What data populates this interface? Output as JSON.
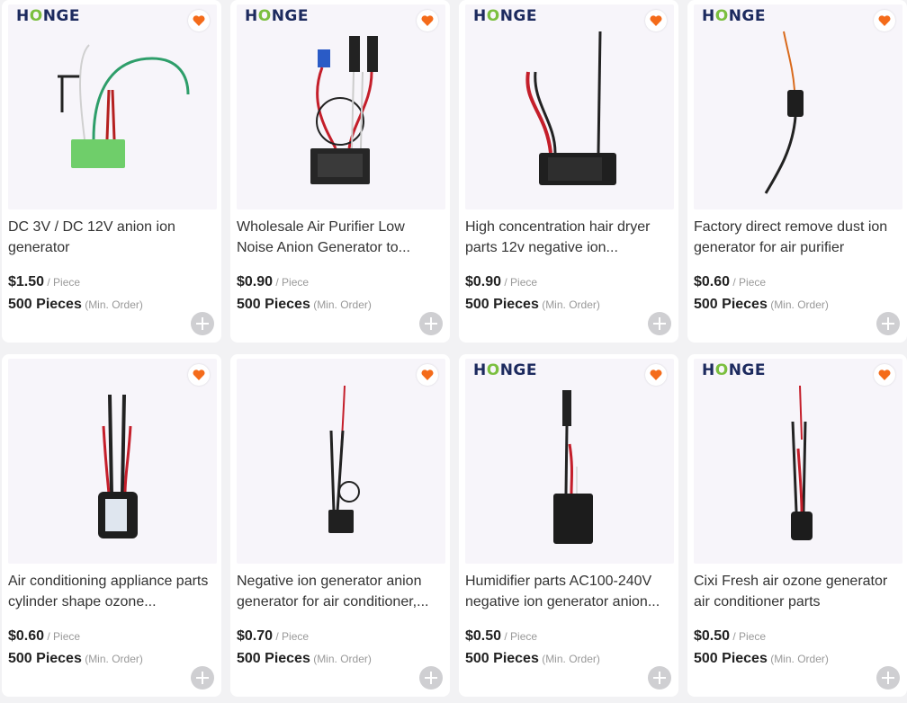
{
  "brand_text": {
    "first": "H",
    "second": "O",
    "rest": "NGE"
  },
  "colors": {
    "heart": "#f46b1a",
    "price": "#222222",
    "muted": "#999999"
  },
  "products": [
    {
      "title": "DC 3V / DC 12V anion ion generator",
      "price": "$1.50",
      "price_unit": " / Piece",
      "moq": "500 Pieces",
      "moq_note": " (Min. Order)",
      "has_brand": true,
      "icon": "heart-icon"
    },
    {
      "title": "Wholesale Air Purifier Low Noise Anion Generator to...",
      "price": "$0.90",
      "price_unit": " / Piece",
      "moq": "500 Pieces",
      "moq_note": " (Min. Order)",
      "has_brand": true,
      "icon": "heart-icon"
    },
    {
      "title": "High concentration hair dryer parts 12v negative ion...",
      "price": "$0.90",
      "price_unit": " / Piece",
      "moq": "500 Pieces",
      "moq_note": " (Min. Order)",
      "has_brand": true,
      "icon": "heart-icon"
    },
    {
      "title": "Factory direct remove dust ion generator for air purifier",
      "price": "$0.60",
      "price_unit": " / Piece",
      "moq": "500 Pieces",
      "moq_note": " (Min. Order)",
      "has_brand": true,
      "icon": "heart-icon"
    },
    {
      "title": "Air conditioning appliance parts cylinder shape ozone...",
      "price": "$0.60",
      "price_unit": " / Piece",
      "moq": "500 Pieces",
      "moq_note": " (Min. Order)",
      "has_brand": false,
      "icon": "heart-icon"
    },
    {
      "title": "Negative ion generator anion generator for air conditioner,...",
      "price": "$0.70",
      "price_unit": " / Piece",
      "moq": "500 Pieces",
      "moq_note": " (Min. Order)",
      "has_brand": false,
      "icon": "heart-icon"
    },
    {
      "title": "Humidifier parts AC100-240V negative ion generator anion...",
      "price": "$0.50",
      "price_unit": " / Piece",
      "moq": "500 Pieces",
      "moq_note": " (Min. Order)",
      "has_brand": true,
      "icon": "heart-icon"
    },
    {
      "title": "Cixi Fresh air ozone generator air conditioner parts",
      "price": "$0.50",
      "price_unit": " / Piece",
      "moq": "500 Pieces",
      "moq_note": " (Min. Order)",
      "has_brand": true,
      "icon": "heart-icon"
    }
  ]
}
